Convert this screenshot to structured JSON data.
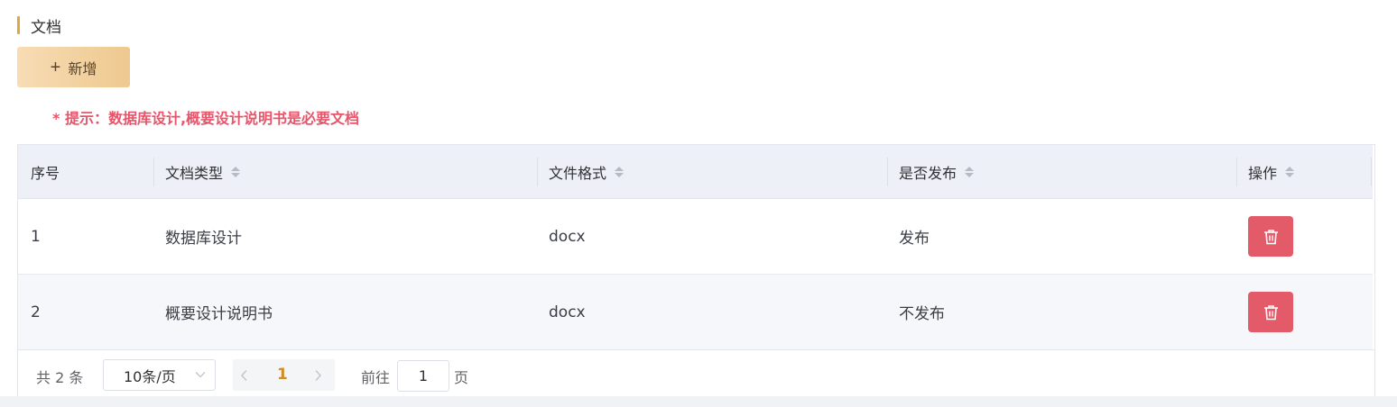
{
  "section": {
    "title": "文档"
  },
  "toolbar": {
    "add_label": "新增"
  },
  "hint": "* 提示：数据库设计,概要设计说明书是必要文档",
  "table": {
    "columns": [
      "序号",
      "文档类型",
      "文件格式",
      "是否发布",
      "操作"
    ],
    "rows": [
      {
        "index": "1",
        "doc_type": "数据库设计",
        "format": "docx",
        "published": "发布"
      },
      {
        "index": "2",
        "doc_type": "概要设计说明书",
        "format": "docx",
        "published": "不发布"
      }
    ],
    "delete_icon": "trash-icon"
  },
  "pagination": {
    "total_text": "共 2 条",
    "page_size": "10条/页",
    "current_page": "1",
    "goto_label": "前往",
    "goto_value": "1",
    "goto_suffix": "页"
  },
  "colors": {
    "accent": "#e0a73a",
    "add_button_gradient": [
      "#f7dcb5",
      "#eec98f"
    ],
    "hint": "#e8546a",
    "delete_button": "#e35b68",
    "current_page": "#cf8d22",
    "header_bg": "#edf0f7"
  }
}
